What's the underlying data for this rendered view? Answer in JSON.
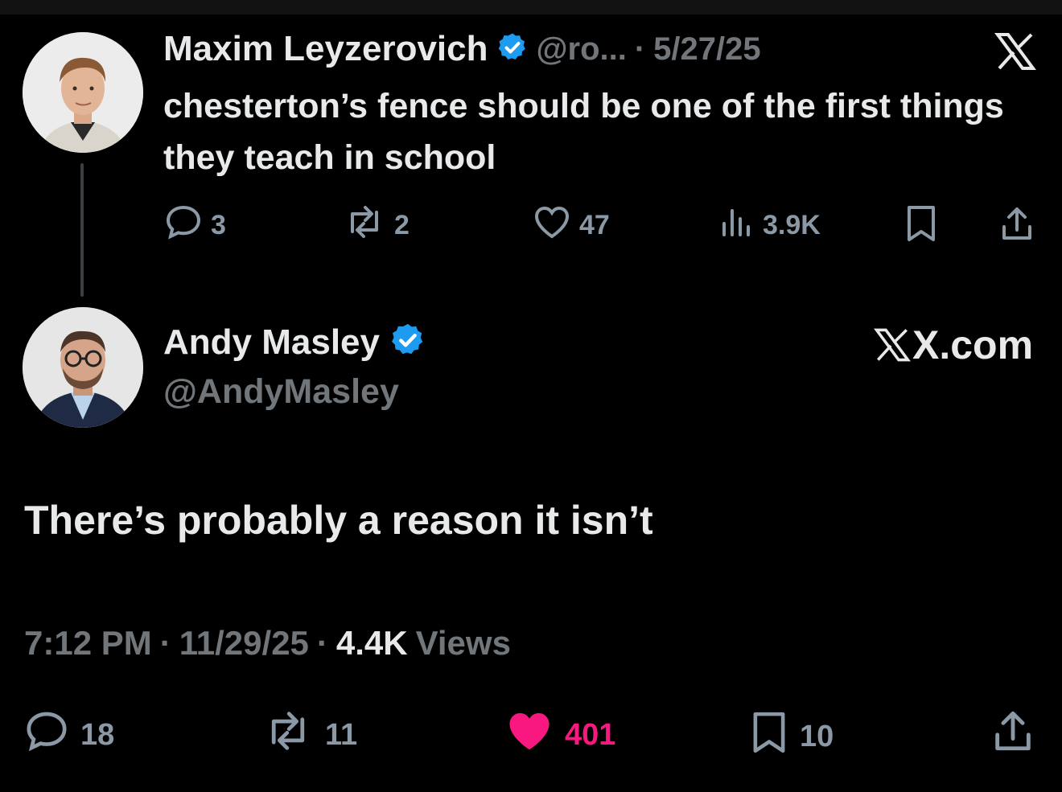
{
  "quoted": {
    "name": "Maxim Leyzerovich",
    "handle": "@ro...",
    "separator": "·",
    "date": "5/27/25",
    "text": "chesterton’s fence should be one of the first things they teach in school",
    "stats": {
      "replies": "3",
      "reposts": "2",
      "likes": "47",
      "views": "3.9K"
    }
  },
  "tweet": {
    "name": "Andy Masley",
    "handle": "@AndyMasley",
    "source": "X.com",
    "text": "There’s probably a reason it isn’t",
    "time": "7:12 PM",
    "sep1": "·",
    "date": "11/29/25",
    "sep2": "·",
    "views_count": "4.4K",
    "views_label": "Views",
    "stats": {
      "replies": "18",
      "reposts": "11",
      "likes": "401",
      "bookmarks": "10"
    }
  },
  "colors": {
    "like_active": "#f91880",
    "verified": "#1d9bf0",
    "muted": "#71767b"
  },
  "icons": [
    "x-logo-icon",
    "verified-badge-icon",
    "reply-icon",
    "repost-icon",
    "like-icon",
    "views-icon",
    "bookmark-icon",
    "share-icon"
  ]
}
